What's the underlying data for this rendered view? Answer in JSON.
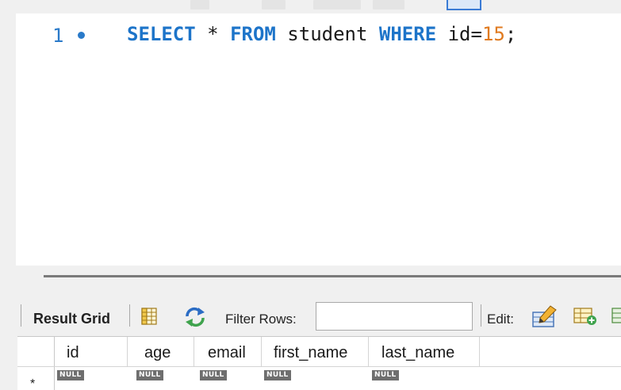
{
  "editor": {
    "line_number": "1",
    "code_tokens": [
      {
        "text": "SELECT",
        "kind": "keyword"
      },
      {
        "text": " * ",
        "kind": "plain"
      },
      {
        "text": "FROM",
        "kind": "keyword"
      },
      {
        "text": " student ",
        "kind": "plain"
      },
      {
        "text": "WHERE",
        "kind": "keyword"
      },
      {
        "text": " id=",
        "kind": "plain"
      },
      {
        "text": "15",
        "kind": "number"
      },
      {
        "text": ";",
        "kind": "plain"
      }
    ]
  },
  "result_toolbar": {
    "result_grid_label": "Result Grid",
    "filter_rows_label": "Filter Rows:",
    "filter_rows_value": "",
    "edit_label": "Edit:",
    "icons": [
      "grid-layout-icon",
      "refresh-icon",
      "edit-pencil-icon",
      "add-row-icon"
    ]
  },
  "result_grid": {
    "columns": [
      "id",
      "age",
      "email",
      "first_name",
      "last_name"
    ],
    "rows": [
      [
        "NULL",
        "NULL",
        "NULL",
        "NULL",
        "NULL"
      ]
    ],
    "new_row_marker": "*"
  },
  "colors": {
    "keyword": "#1d74c9",
    "number": "#e07a1f",
    "line_number": "#2a7ac9",
    "null_badge": "#6e6e6e"
  }
}
